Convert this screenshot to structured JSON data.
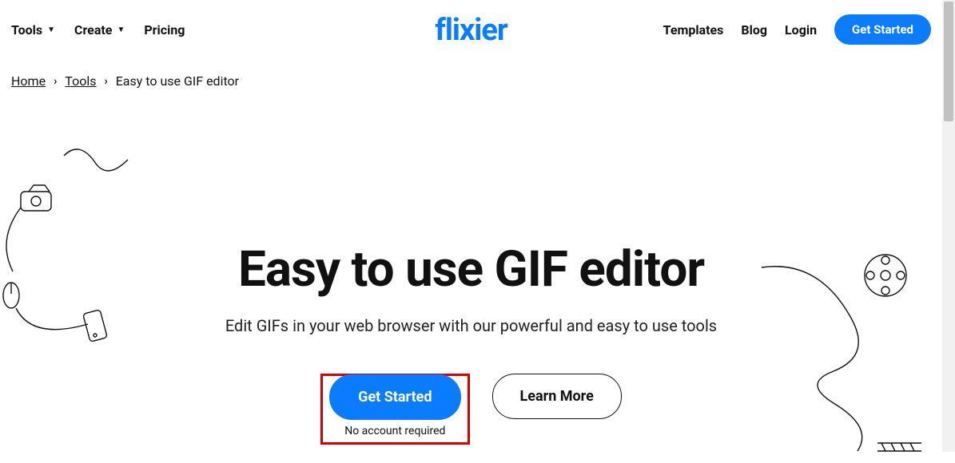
{
  "header": {
    "logo": "flixier",
    "left": [
      {
        "label": "Tools",
        "has_caret": true
      },
      {
        "label": "Create",
        "has_caret": true
      },
      {
        "label": "Pricing",
        "has_caret": false
      }
    ],
    "right": {
      "templates": "Templates",
      "blog": "Blog",
      "login": "Login",
      "cta": "Get Started"
    }
  },
  "breadcrumb": {
    "home": "Home",
    "tools": "Tools",
    "current": "Easy to use GIF editor"
  },
  "hero": {
    "title": "Easy to use GIF editor",
    "subtitle": "Edit GIFs in your web browser with our powerful and easy to use tools",
    "primary_cta": "Get Started",
    "primary_cta_sub": "No account required",
    "secondary_cta": "Learn More"
  },
  "colors": {
    "brand": "#0a7cff",
    "highlight_box": "#d60000"
  }
}
